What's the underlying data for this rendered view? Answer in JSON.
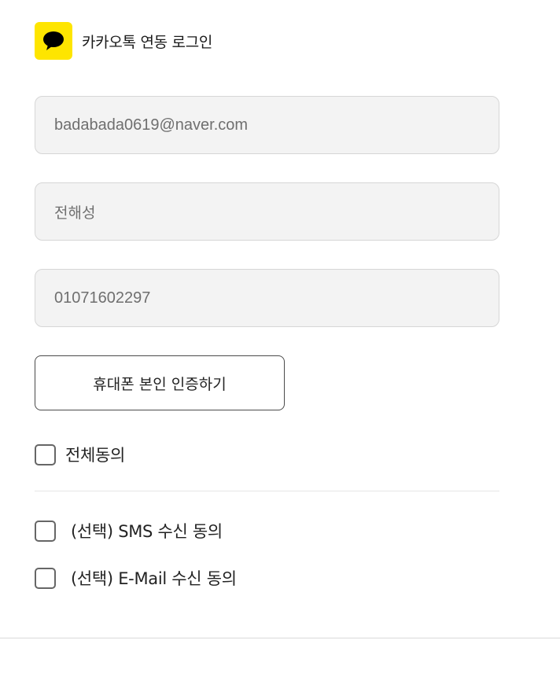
{
  "header": {
    "title": "카카오톡 연동 로그인",
    "icon": "kakao-speech-bubble-icon",
    "brand_color": "#FEE500"
  },
  "form": {
    "email_value": "badabada0619@naver.com",
    "name_value": "전해성",
    "phone_value": "01071602297",
    "verify_button_label": "휴대폰 본인 인증하기"
  },
  "agreements": {
    "all_label": "전체동의",
    "all_checked": false,
    "items": [
      {
        "label": "(선택) SMS 수신 동의",
        "checked": false
      },
      {
        "label": "(선택) E-Mail 수신 동의",
        "checked": false
      }
    ]
  }
}
